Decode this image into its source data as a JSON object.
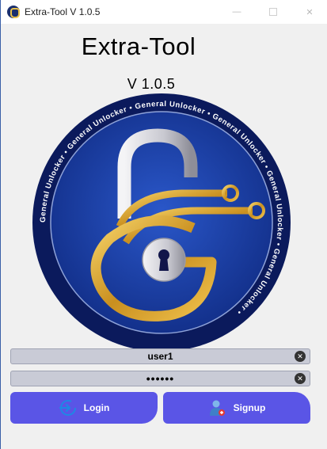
{
  "window": {
    "title": "Extra-Tool V 1.0.5",
    "controls": {
      "minimize": "—",
      "close": "✕"
    }
  },
  "header": {
    "app_name": "Extra-Tool",
    "version": "V 1.0.5"
  },
  "logo": {
    "ring_text": "General Unlocker • General Unlocker • General Unlocker • General Unlocker • General Unlocker • General Unlocker • ",
    "colors": {
      "ring": "#0d1f66",
      "disc": "#1b3fa8",
      "gold": "#d9a92c",
      "silver": "#e6e6ea"
    }
  },
  "form": {
    "username": {
      "value": "user1"
    },
    "password": {
      "value": "••••••"
    },
    "clear_glyph": "✕"
  },
  "actions": {
    "login_label": "Login",
    "signup_label": "Signup",
    "accent": "#5a55e6"
  }
}
